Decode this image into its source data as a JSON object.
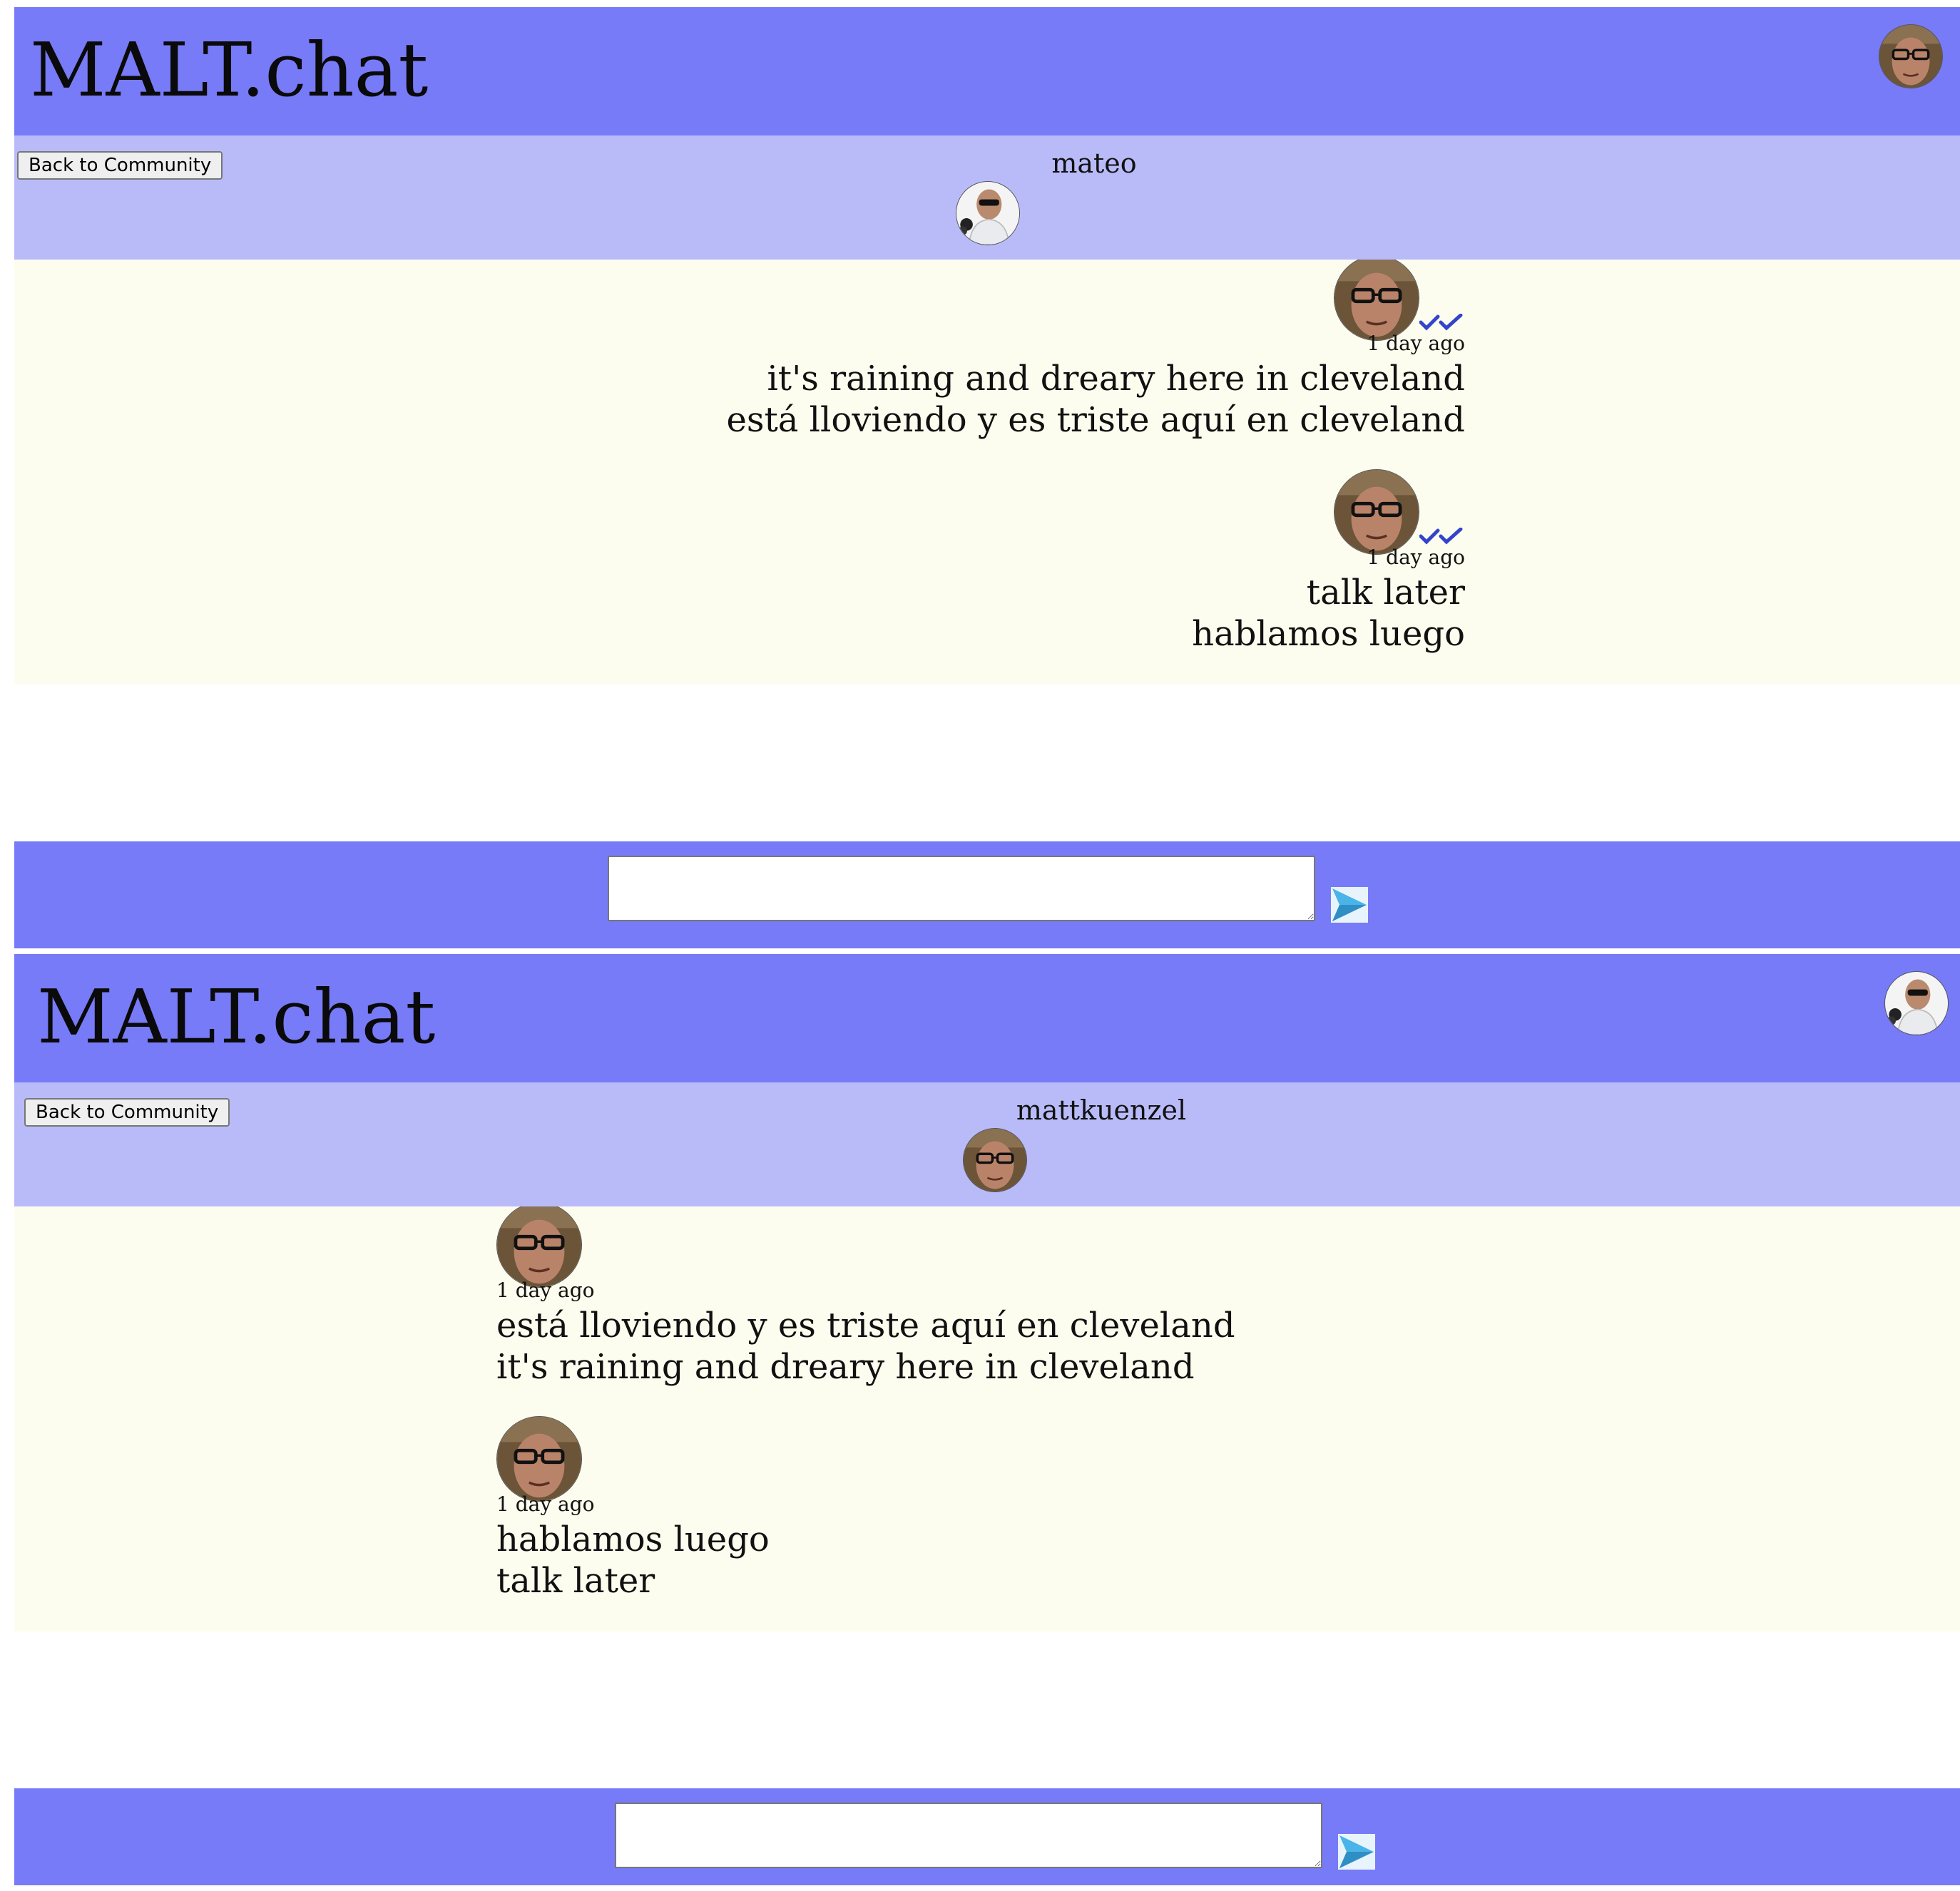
{
  "app": {
    "title": "MALT.chat",
    "back_label": "Back to Community"
  },
  "colors": {
    "header": "#777bf7",
    "subheader": "#b9bbf9",
    "message_area": "#fdfdef",
    "read_checks": "#3344cc",
    "send_icon": "#4ab3e8"
  },
  "icons": {
    "read_receipt": "double-check-icon",
    "send": "send-arrow-icon"
  },
  "panels": [
    {
      "partner_name": "mateo",
      "messages": [
        {
          "direction": "sent",
          "time": "1 day ago",
          "read": true,
          "lines": [
            "it's raining and dreary here in cleveland",
            "está lloviendo y es triste aquí en cleveland"
          ]
        },
        {
          "direction": "sent",
          "time": "1 day ago",
          "read": true,
          "lines": [
            "talk later",
            "hablamos luego"
          ]
        }
      ],
      "input_value": ""
    },
    {
      "partner_name": "mattkuenzel",
      "messages": [
        {
          "direction": "received",
          "time": "1 day ago",
          "lines": [
            "está lloviendo y es triste aquí en cleveland",
            "it's raining and dreary here in cleveland"
          ]
        },
        {
          "direction": "received",
          "time": "1 day ago",
          "lines": [
            "hablamos luego",
            "talk later"
          ]
        }
      ],
      "input_value": ""
    }
  ]
}
